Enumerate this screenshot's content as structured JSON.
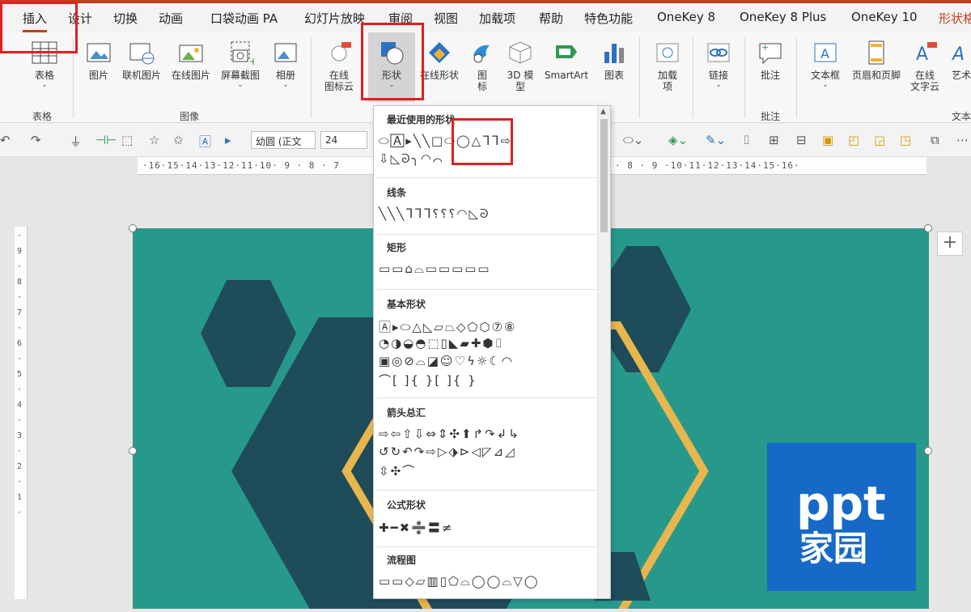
{
  "tabs": [
    "插入",
    "设计",
    "切换",
    "动画",
    "口袋动画 PA",
    "幻灯片放映",
    "审阅",
    "视图",
    "加载项",
    "帮助",
    "特色功能",
    "OneKey 8",
    "OneKey 8 Plus",
    "OneKey 10",
    "形状格"
  ],
  "ribbon": {
    "table": {
      "label": "表格",
      "group": "表格"
    },
    "image_buttons": [
      "图片",
      "联机图片",
      "在线图片",
      "屏幕截图",
      "相册"
    ],
    "image_group": "图像",
    "online_icons": [
      "在线",
      "图标云"
    ],
    "shapes": "形状",
    "online_shapes": "在线形状",
    "icons": [
      "图",
      "标"
    ],
    "model3d": [
      "3D 模",
      "型"
    ],
    "smartart": "SmartArt",
    "chart": "图表",
    "addins": [
      "加载",
      "项"
    ],
    "link": "链接",
    "comment": "批注",
    "comment_group": "批注",
    "textbox": "文本框",
    "header_footer": "页眉和页脚",
    "online_text": [
      "在线",
      "文字云"
    ],
    "art": "艺术",
    "text_group": "文本"
  },
  "qat": {
    "font": "幼圆 (正文",
    "size": "24"
  },
  "ruler": {
    "left": "·16·15·14·13·12·11·10· 9 · 8 · 7",
    "right": "· 8 · 9 ·10·11·12·13·14·15·16·",
    "vertical": "·9·8·7·6·5·4·3·2·1·"
  },
  "dropdown": {
    "recent": "最近使用的形状",
    "recent_row1": "⬭🄰▸╲╲□⬭◯△ᒣᒣ⇨",
    "recent_row2": "⇩◺ᘐ╮◠⌒",
    "lines": "线条",
    "lines_row": "╲╲╲ᒣᒣᒣ⸮⸮⸮◠◺ᘐ",
    "rect": "矩形",
    "rect_row": "▭▭⌂⌓▭▭▭▭▭",
    "basic": "基本形状",
    "basic_rows": [
      "🄰▸⬭△◺▱⏢◇⬠⬡⑦⑧",
      "◔◑◒◓⬚▯◣▰✚⬢⌷",
      "▣◎⊘⌓◪☺♡ϟ☼☾◠",
      "⌒[ ]{ }[ ]{ }"
    ],
    "arrows": "箭头总汇",
    "arrow_rows": [
      "⇨⇦⇧⇩⇔⇕✣⬆↱↷↲↳",
      "↺↻↶↷⇨▷⬗⊳◁◸⊿◿",
      "⇳✣⌒"
    ],
    "equation": "公式形状",
    "equation_row": "✚━✖➗〓≠",
    "flowchart": "流程图",
    "flow_row": "▭▭◇▱▥▯⬠⌓◯◯⌓▽◯"
  },
  "logo": {
    "ppt": "ppt",
    "jy": "家园"
  },
  "colors": {
    "slide": "#27998b",
    "hex_dark": "#1f4c5a",
    "gold": "#e8b64c",
    "logo": "#1769c7",
    "accent": "#c43e1c",
    "annotate": "#e02020"
  }
}
